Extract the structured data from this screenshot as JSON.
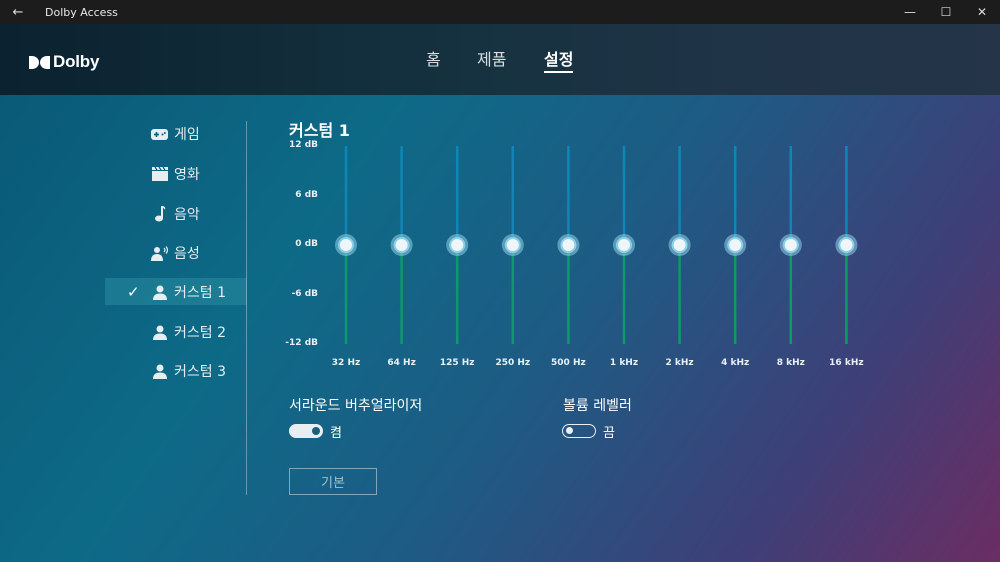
{
  "window": {
    "title": "Dolby Access",
    "back_glyph": "←",
    "controls": [
      "—",
      "☐",
      "✕"
    ]
  },
  "header": {
    "logo_text": "Dolby",
    "tabs": [
      {
        "label": "홈"
      },
      {
        "label": "제품"
      },
      {
        "label": "설정",
        "active": true
      }
    ]
  },
  "sidebar": {
    "items": [
      {
        "label": "게임",
        "icon": "gamepad-icon"
      },
      {
        "label": "영화",
        "icon": "clapperboard-icon"
      },
      {
        "label": "음악",
        "icon": "music-note-icon"
      },
      {
        "label": "음성",
        "icon": "speaking-person-icon"
      },
      {
        "label": "커스텀 1",
        "icon": "person-icon",
        "selected": true
      },
      {
        "label": "커스텀 2",
        "icon": "person-icon"
      },
      {
        "label": "커스텀 3",
        "icon": "person-icon"
      }
    ],
    "selected_mark": "✓"
  },
  "equalizer": {
    "title": "커스텀 1",
    "y_labels": [
      "12 dB",
      "6 dB",
      "0 dB",
      "-6 dB",
      "-12 dB"
    ],
    "y_range": [
      -12,
      12
    ],
    "bands": [
      {
        "freq": "32 Hz",
        "gain_db": 0
      },
      {
        "freq": "64 Hz",
        "gain_db": 0
      },
      {
        "freq": "125 Hz",
        "gain_db": 0
      },
      {
        "freq": "250 Hz",
        "gain_db": 0
      },
      {
        "freq": "500 Hz",
        "gain_db": 0
      },
      {
        "freq": "1 kHz",
        "gain_db": 0
      },
      {
        "freq": "2 kHz",
        "gain_db": 0
      },
      {
        "freq": "4 kHz",
        "gain_db": 0
      },
      {
        "freq": "8 kHz",
        "gain_db": 0
      },
      {
        "freq": "16 kHz",
        "gain_db": 0
      }
    ],
    "colors": {
      "upper": "#0f86b8",
      "lower": "#0d9a6a",
      "knob_ring": "#8ecfe8"
    }
  },
  "settings": {
    "surround": {
      "label": "서라운드 버추얼라이저",
      "state_label": "켬",
      "on": true
    },
    "volume": {
      "label": "볼륨 레벨러",
      "state_label": "끔",
      "on": false
    },
    "reset_label": "기본"
  }
}
